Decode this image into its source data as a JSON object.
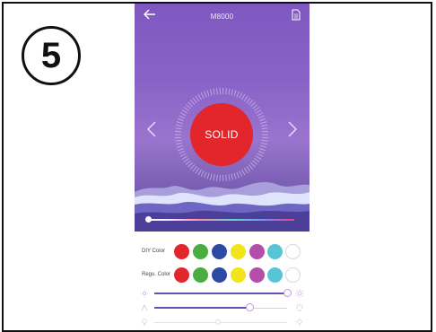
{
  "step_number": "5",
  "header": {
    "title": "M8000"
  },
  "mode_button": {
    "label": "SOLID"
  },
  "diy_row": {
    "label": "DIY Color",
    "swatches": [
      "#e3262c",
      "#4aad3f",
      "#2c4aa3",
      "#f2e31b",
      "#b54ea8",
      "#58c5d6",
      "#ffffff"
    ]
  },
  "regu_row": {
    "label": "Regu. Color",
    "swatches": [
      "#e3262c",
      "#4aad3f",
      "#2c4aa3",
      "#f2e31b",
      "#b54ea8",
      "#58c5d6",
      "#ffffff"
    ]
  },
  "sliders": {
    "brightness": 1.0,
    "saturation": 0.72,
    "speed": 0.48
  },
  "color_slider_position": 0.0
}
